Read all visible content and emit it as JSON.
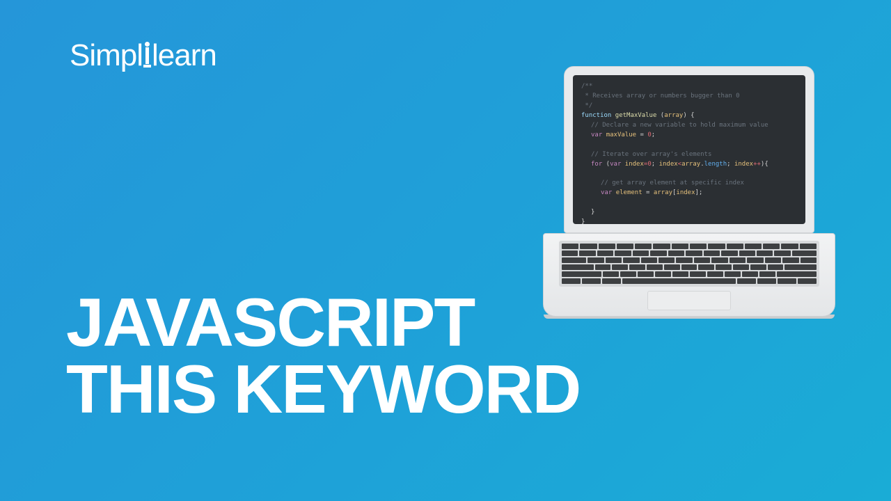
{
  "brand": {
    "part1": "Simpl",
    "part2": "learn"
  },
  "title": {
    "line1": "JAVASCRIPT",
    "line2": "THIS KEYWORD"
  },
  "code": {
    "c1": "/**",
    "c2": " * Receives array or numbers bugger than 0",
    "c3": " */",
    "kw_function": "function",
    "fn_name": "getMaxValue",
    "paren_open": " (",
    "arg": "array",
    "paren_close_brace": ") {",
    "c4": "// Declare a new variable to hold maximum value",
    "kw_var": "var",
    "v_maxValue": "maxValue",
    "eq": " = ",
    "zero": "0",
    "semi": ";",
    "c5": "// Iterate over array's elements",
    "kw_for": "for",
    "for_open": " (",
    "v_index": "index",
    "assign0": "=",
    "lt": "<",
    "dot": ".",
    "length": "length",
    "pp": "++",
    "for_close": "){",
    "c6": "// get array element at specific index",
    "v_element": "element",
    "br_open": "[",
    "br_close": "]",
    "brace_close": "}"
  }
}
